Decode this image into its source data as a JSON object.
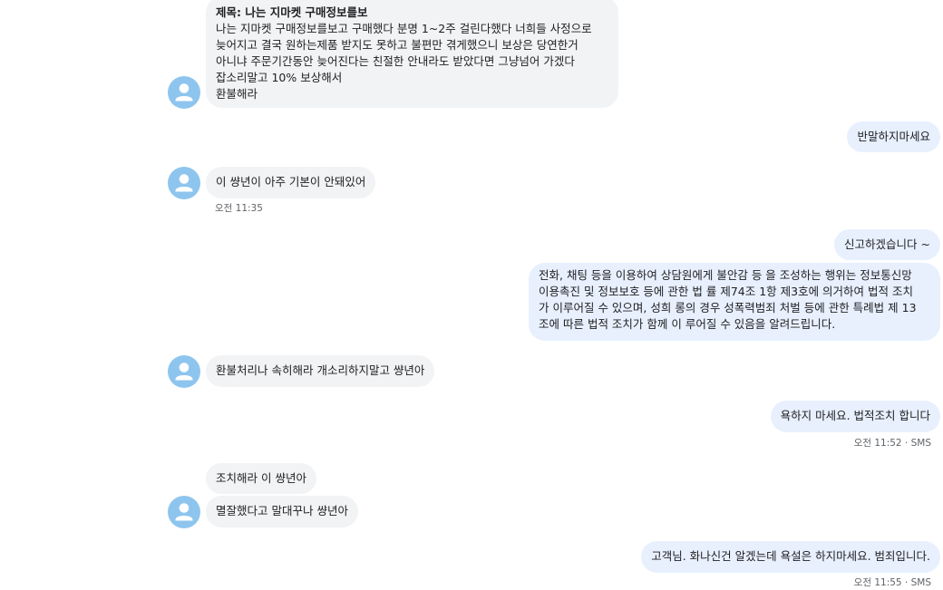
{
  "messages": {
    "m1": {
      "subject": "제목: 나는 지마켓 구매정보를보",
      "lines": [
        "나는 지마켓 구매정보를보고 구매했다 분명 1~2주 걸린다했다 너희들 사정으로",
        "늦어지고 결국 원하는제품 받지도 못하고 불편만 겪게했으니 보상은 당연한거",
        "아니냐 주문기간동안 늦어진다는 친절한 안내라도 받았다면 그냥넘어 가겠다",
        "잡소리말고 10% 보상해서",
        "환불해라"
      ]
    },
    "m2": {
      "text": "반말하지마세요"
    },
    "m3": {
      "text": "이 썅년이 아주 기본이 안돼있어",
      "time": "오전 11:35"
    },
    "m4": {
      "text": "신고하겠습니다 ~"
    },
    "m5": {
      "lines": [
        "전화, 채팅 등을 이용하여 상담원에게 불안감 등 을 조성하는 행위는 정보통신망",
        "이용촉진 및 정보보호 등에 관한 법 률 제74조 1항 제3호에 의거하여 법적 조치",
        "가 이루어질 수 있으며, 성희 롱의 경우 성폭력범죄 처벌 등에 관한 특례법 제 13",
        "조에 따른 법적 조치가 함께 이 루어질 수 있음을 알려드립니다."
      ]
    },
    "m6": {
      "text": "환불처리나 속히해라 개소리하지말고 썅년아"
    },
    "m7": {
      "text": "욕하지 마세요. 법적조치 합니다",
      "time": "오전 11:52 · SMS"
    },
    "m8": {
      "text": "조치해라 이 썅년아"
    },
    "m9": {
      "text": "멸잘했다고 말대꾸나 썅년아"
    },
    "m10": {
      "text": "고객님. 화나신건 알겠는데 욕설은 하지마세요. 범죄입니다.",
      "time": "오전 11:55 · SMS"
    }
  },
  "colors": {
    "incoming_bubble": "#f1f3f4",
    "outgoing_bubble": "#e8f0fe",
    "avatar": "#8ec5ee",
    "timestamp": "#5f6368"
  },
  "icons": {
    "avatar": "person-avatar-icon"
  }
}
